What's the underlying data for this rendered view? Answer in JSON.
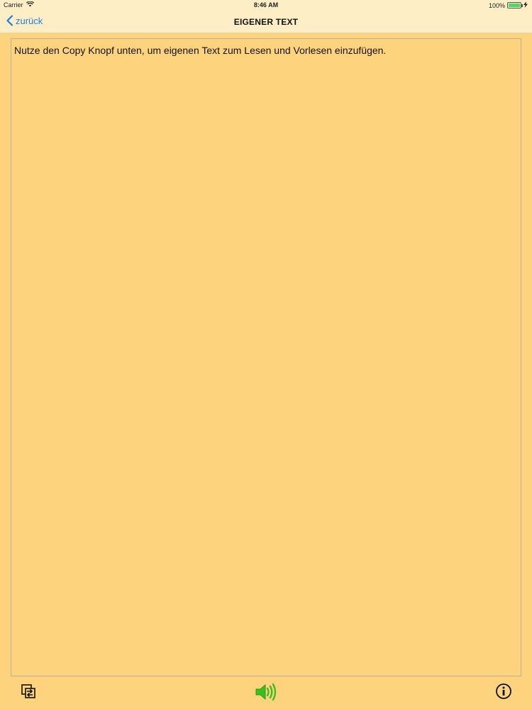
{
  "status_bar": {
    "carrier": "Carrier",
    "time": "8:46 AM",
    "battery_text": "100%",
    "battery_level": 1.0,
    "icons": [
      "wifi-icon",
      "battery-icon",
      "charging-icon"
    ]
  },
  "nav": {
    "back_label": "zurück",
    "title": "EIGENER TEXT"
  },
  "content": {
    "text": "Nutze den Copy Knopf unten, um eigenen Text zum Lesen und Vorlesen einzufügen."
  },
  "toolbar": {
    "icons": [
      "copy-paste-icon",
      "speaker-icon",
      "info-icon"
    ]
  },
  "colors": {
    "background": "#fed37e",
    "bar_background": "#fdeec5",
    "accent_blue": "#1f7fe0",
    "speaker_green": "#3bbf1d"
  }
}
